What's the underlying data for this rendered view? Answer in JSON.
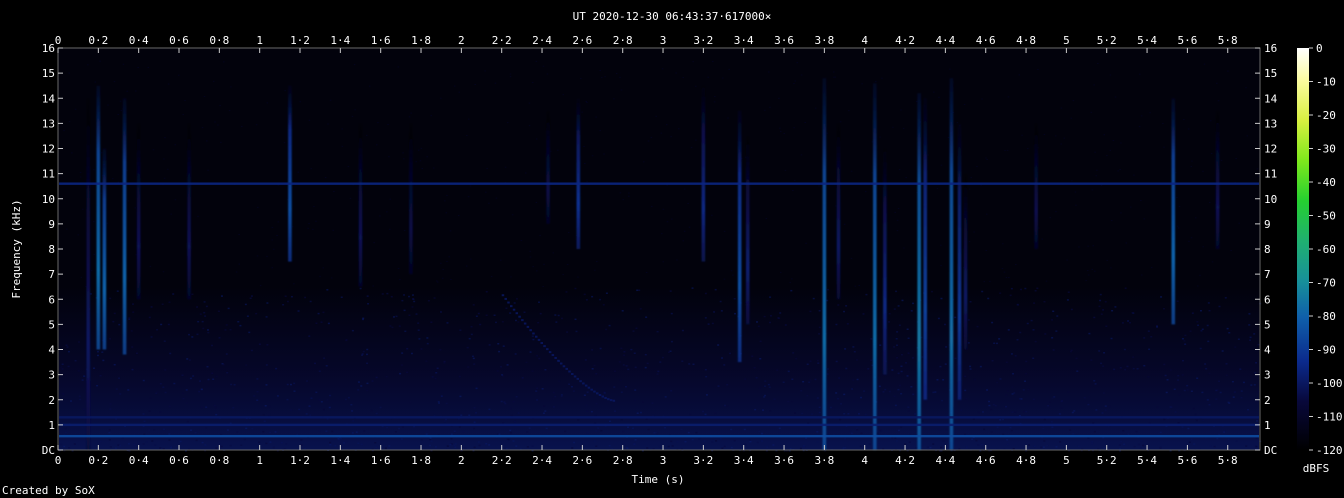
{
  "chart_data": {
    "type": "heatmap",
    "title": "UT 2020-12-30 06:43:37·617000×",
    "xlabel": "Time (s)",
    "ylabel": "Frequency (kHz)",
    "xlim": [
      0,
      5.96
    ],
    "ylim": [
      0,
      16
    ],
    "x_ticks": [
      "0",
      "0·2",
      "0·4",
      "0·6",
      "0·8",
      "1",
      "1·2",
      "1·4",
      "1·6",
      "1·8",
      "2",
      "2·2",
      "2·4",
      "2·6",
      "2·8",
      "3",
      "3·2",
      "3·4",
      "3·6",
      "3·8",
      "4",
      "4·2",
      "4·4",
      "4·6",
      "4·8",
      "5",
      "5·2",
      "5·4",
      "5·6",
      "5·8"
    ],
    "y_ticks": [
      "DC",
      "1",
      "2",
      "3",
      "4",
      "5",
      "6",
      "7",
      "8",
      "9",
      "10",
      "11",
      "12",
      "13",
      "14",
      "15",
      "16"
    ],
    "colorbar": {
      "label": "dBFS",
      "min": -120,
      "max": 0,
      "ticks": [
        "0",
        "-10",
        "-20",
        "-30",
        "-40",
        "-50",
        "-60",
        "-70",
        "-80",
        "-90",
        "-100",
        "-110",
        "-120"
      ]
    },
    "features": {
      "background_dbfs": -115,
      "broadband_band": {
        "f_low_khz": 0,
        "f_high_khz": 6.5,
        "dbfs": -105
      },
      "hum_lines": [
        {
          "f_khz": 0.55,
          "dbfs": -85
        },
        {
          "f_khz": 1.0,
          "dbfs": -98
        },
        {
          "f_khz": 1.3,
          "dbfs": -100
        },
        {
          "f_khz": 10.6,
          "dbfs": -95
        }
      ],
      "transients": [
        {
          "t": 0.15,
          "f_low_khz": 0,
          "f_high_khz": 14,
          "dbfs": -100
        },
        {
          "t": 0.2,
          "f_low_khz": 4,
          "f_high_khz": 14.5,
          "dbfs": -78
        },
        {
          "t": 0.23,
          "f_low_khz": 4,
          "f_high_khz": 12,
          "dbfs": -80
        },
        {
          "t": 0.33,
          "f_low_khz": 3.8,
          "f_high_khz": 14,
          "dbfs": -80
        },
        {
          "t": 0.4,
          "f_low_khz": 6,
          "f_high_khz": 13,
          "dbfs": -102
        },
        {
          "t": 0.65,
          "f_low_khz": 6,
          "f_high_khz": 13,
          "dbfs": -102
        },
        {
          "t": 1.15,
          "f_low_khz": 7.5,
          "f_high_khz": 14.5,
          "dbfs": -85
        },
        {
          "t": 1.5,
          "f_low_khz": 6.5,
          "f_high_khz": 13,
          "dbfs": -102
        },
        {
          "t": 1.75,
          "f_low_khz": 7,
          "f_high_khz": 13,
          "dbfs": -104
        },
        {
          "t": 2.43,
          "f_low_khz": 9,
          "f_high_khz": 13.5,
          "dbfs": -104
        },
        {
          "t": 2.58,
          "f_low_khz": 8,
          "f_high_khz": 14,
          "dbfs": -92
        },
        {
          "t": 3.2,
          "f_low_khz": 7.5,
          "f_high_khz": 14.5,
          "dbfs": -95
        },
        {
          "t": 3.38,
          "f_low_khz": 3.5,
          "f_high_khz": 13.5,
          "dbfs": -85
        },
        {
          "t": 3.42,
          "f_low_khz": 5,
          "f_high_khz": 12.5,
          "dbfs": -98
        },
        {
          "t": 3.8,
          "f_low_khz": 0,
          "f_high_khz": 14.8,
          "dbfs": -78
        },
        {
          "t": 3.87,
          "f_low_khz": 6,
          "f_high_khz": 13,
          "dbfs": -100
        },
        {
          "t": 4.05,
          "f_low_khz": 0,
          "f_high_khz": 14.6,
          "dbfs": -78
        },
        {
          "t": 4.1,
          "f_low_khz": 3,
          "f_high_khz": 12,
          "dbfs": -95
        },
        {
          "t": 4.27,
          "f_low_khz": 0,
          "f_high_khz": 14.2,
          "dbfs": -75
        },
        {
          "t": 4.3,
          "f_low_khz": 2,
          "f_high_khz": 14,
          "dbfs": -88
        },
        {
          "t": 4.43,
          "f_low_khz": 0,
          "f_high_khz": 14.8,
          "dbfs": -77
        },
        {
          "t": 4.47,
          "f_low_khz": 2,
          "f_high_khz": 13,
          "dbfs": -90
        },
        {
          "t": 4.5,
          "f_low_khz": 4,
          "f_high_khz": 11,
          "dbfs": -100
        },
        {
          "t": 4.85,
          "f_low_khz": 8,
          "f_high_khz": 13,
          "dbfs": -103
        },
        {
          "t": 5.53,
          "f_low_khz": 5,
          "f_high_khz": 14,
          "dbfs": -80
        },
        {
          "t": 5.75,
          "f_low_khz": 8,
          "f_high_khz": 13.5,
          "dbfs": -102
        }
      ],
      "sweep": {
        "t_start": 2.2,
        "f_start_khz": 6.2,
        "t_end": 2.75,
        "f_end_khz": 2.0,
        "dbfs": -100
      }
    }
  },
  "footer": {
    "credit": "Created by SoX"
  }
}
